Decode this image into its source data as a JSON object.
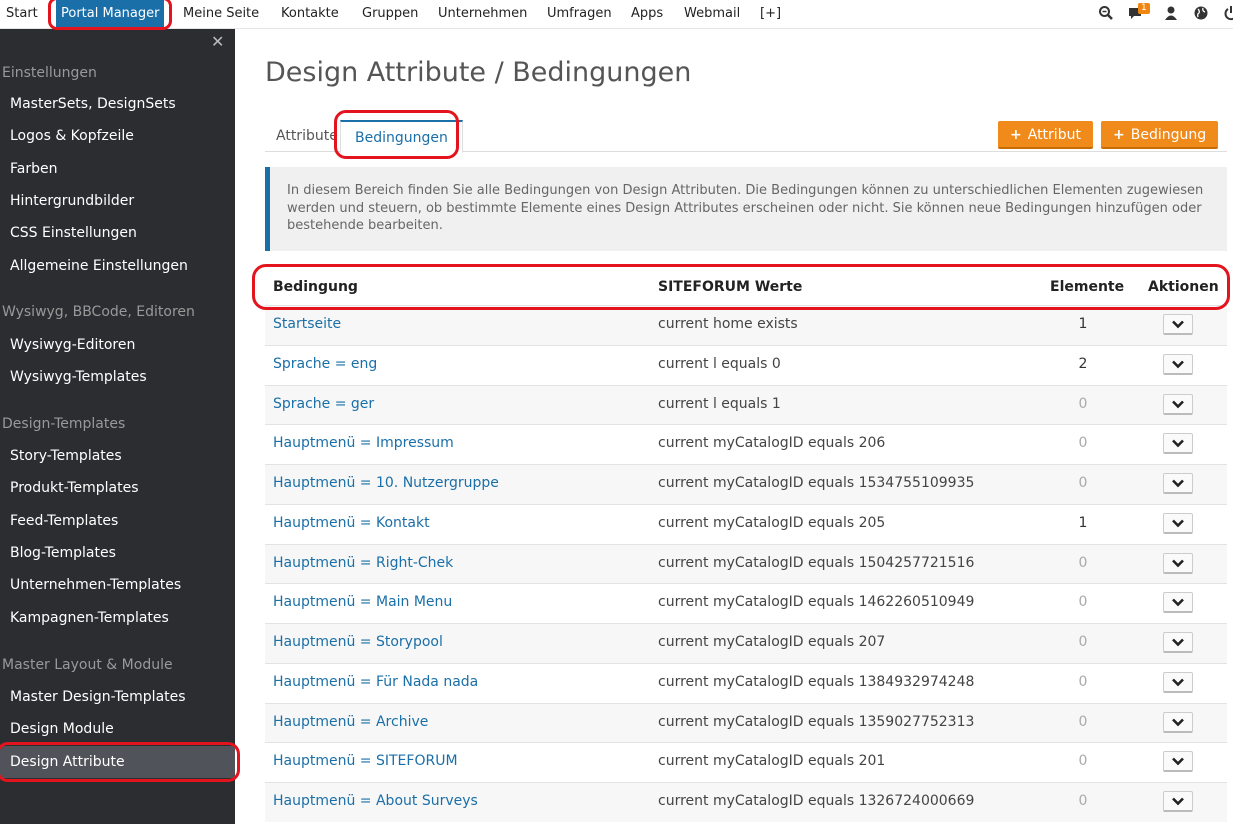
{
  "topnav": {
    "items": [
      "Start",
      "Portal Manager",
      "Meine Seite",
      "Kontakte",
      "Gruppen",
      "Unternehmen",
      "Umfragen",
      "Apps",
      "Webmail",
      "[+]"
    ],
    "badge_count": "1"
  },
  "sidebar": {
    "sections": [
      {
        "title": "Einstellungen",
        "items": [
          "MasterSets, DesignSets",
          "Logos & Kopfzeile",
          "Farben",
          "Hintergrundbilder",
          "CSS Einstellungen",
          "Allgemeine Einstellungen"
        ]
      },
      {
        "title": "Wysiwyg, BBCode, Editoren",
        "items": [
          "Wysiwyg-Editoren",
          "Wysiwyg-Templates"
        ]
      },
      {
        "title": "Design-Templates",
        "items": [
          "Story-Templates",
          "Produkt-Templates",
          "Feed-Templates",
          "Blog-Templates",
          "Unternehmen-Templates",
          "Kampagnen-Templates"
        ]
      },
      {
        "title": "Master Layout & Module",
        "items": [
          "Master Design-Templates",
          "Design Module",
          "Design Attribute"
        ]
      }
    ]
  },
  "main": {
    "title": "Design Attribute / Bedingungen",
    "tabs": [
      "Attribute",
      "Bedingungen"
    ],
    "buttons": {
      "add_attribute": "Attribut",
      "add_condition": "Bedingung"
    },
    "info_text": "In diesem Bereich finden Sie alle Bedingungen von Design Attributen. Die Bedingungen können zu unterschiedlichen Elementen zugewiesen werden und steuern, ob bestimmte Elemente eines Design Attributes erscheinen oder nicht. Sie können neue Bedingungen hinzufügen oder bestehende bearbeiten.",
    "table": {
      "headers": [
        "Bedingung",
        "SITEFORUM Werte",
        "Elemente",
        "Aktionen"
      ],
      "rows": [
        {
          "name": "Startseite",
          "value": "current home exists",
          "elements": "1"
        },
        {
          "name": "Sprache = eng",
          "value": "current l equals 0",
          "elements": "2"
        },
        {
          "name": "Sprache = ger",
          "value": "current l equals 1",
          "elements": "0"
        },
        {
          "name": "Hauptmenü = Impressum",
          "value": "current myCatalogID equals 206",
          "elements": "0"
        },
        {
          "name": "Hauptmenü = 10. Nutzergruppe",
          "value": "current myCatalogID equals 1534755109935",
          "elements": "0"
        },
        {
          "name": "Hauptmenü = Kontakt",
          "value": "current myCatalogID equals 205",
          "elements": "1"
        },
        {
          "name": "Hauptmenü = Right-Chek",
          "value": "current myCatalogID equals 1504257721516",
          "elements": "0"
        },
        {
          "name": "Hauptmenü = Main Menu",
          "value": "current myCatalogID equals 1462260510949",
          "elements": "0"
        },
        {
          "name": "Hauptmenü = Storypool",
          "value": "current myCatalogID equals 207",
          "elements": "0"
        },
        {
          "name": "Hauptmenü = Für Nada nada",
          "value": "current myCatalogID equals 1384932974248",
          "elements": "0"
        },
        {
          "name": "Hauptmenü = Archive",
          "value": "current myCatalogID equals 1359027752313",
          "elements": "0"
        },
        {
          "name": "Hauptmenü = SITEFORUM",
          "value": "current myCatalogID equals 201",
          "elements": "0"
        },
        {
          "name": "Hauptmenü = About Surveys",
          "value": "current myCatalogID equals 1326724000669",
          "elements": "0"
        }
      ]
    }
  },
  "colors": {
    "accent": "#1a6fa8",
    "orange": "#f08a1b",
    "highlight": "#e3141d",
    "sidebar_bg": "#2b2d31"
  }
}
